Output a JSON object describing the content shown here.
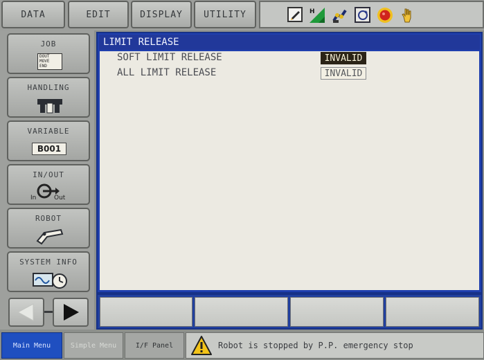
{
  "menu": {
    "tabs": [
      "DATA",
      "EDIT",
      "DISPLAY",
      "UTILITY"
    ],
    "status_icons": [
      "edit-mode-icon",
      "signal-level-icon",
      "robot-arm-icon",
      "cycle-icon",
      "emergency-stop-icon",
      "teach-hand-icon"
    ]
  },
  "sidebar": {
    "job": {
      "label": "JOB",
      "icon_lines": [
        "DOUT",
        "MOVE",
        "END"
      ]
    },
    "handling": {
      "label": "HANDLING"
    },
    "variable": {
      "label": "VARIABLE",
      "value": "B001"
    },
    "inout": {
      "label": "IN/OUT",
      "in_label": "In",
      "out_label": "Out"
    },
    "robot": {
      "label": "ROBOT"
    },
    "system_info": {
      "label": "SYSTEM INFO"
    }
  },
  "window": {
    "title": "LIMIT RELEASE",
    "rows": [
      {
        "label": "SOFT LIMIT RELEASE",
        "value": "INVALID"
      },
      {
        "label": "ALL LIMIT RELEASE",
        "value": "INVALID"
      }
    ]
  },
  "bottom": {
    "main_menu": "Main Menu",
    "simple_menu": "Simple Menu",
    "if_panel": "I/F Panel",
    "message": "Robot is stopped by P.P. emergency stop"
  },
  "colors": {
    "title_bar": "#21389a",
    "selected_value": "#2a2316",
    "main_menu_active": "#1f4fc0",
    "warning_icon": "#f2c318"
  }
}
